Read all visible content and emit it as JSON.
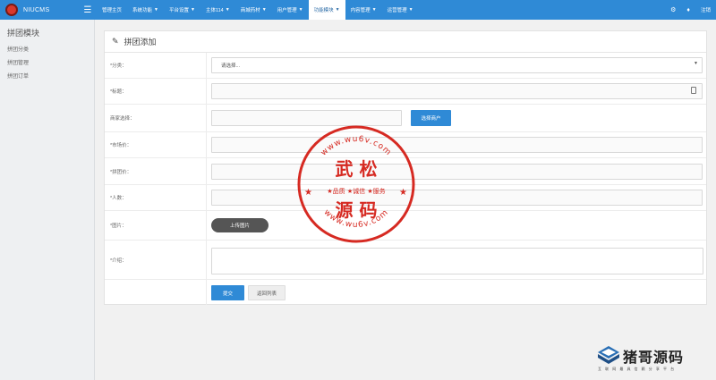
{
  "app": {
    "brand": "NIUCMS"
  },
  "nav": {
    "items": [
      {
        "label": "管理主页",
        "caret": false
      },
      {
        "label": "系统功能",
        "caret": true
      },
      {
        "label": "平台设置",
        "caret": true
      },
      {
        "label": "主体114",
        "caret": true
      },
      {
        "label": "商城药材",
        "caret": true
      },
      {
        "label": "用户管理",
        "caret": true
      },
      {
        "label": "功能模块",
        "caret": true,
        "active": true
      },
      {
        "label": "内容管理",
        "caret": true
      },
      {
        "label": "运营管理",
        "caret": true
      }
    ],
    "logout": "注销"
  },
  "sidebar": {
    "title": "拼团模块",
    "items": [
      "拼团分类",
      "拼团管理",
      "拼团订单"
    ]
  },
  "panel": {
    "title": "拼团添加",
    "fields": {
      "category_label": "*分类：",
      "category_value": "请选择...",
      "title_label": "*标题：",
      "merchant_label": "商家选择：",
      "merchant_button": "选择商户",
      "market_price_label": "*市场价：",
      "group_price_label": "*拼团价：",
      "people_label": "*人数：",
      "image_label": "*图片：",
      "upload_button": "上传图片",
      "intro_label": "*介绍："
    },
    "actions": {
      "submit": "提交",
      "back": "返回列表"
    }
  },
  "watermark": {
    "seal_top": "www.wu6v.com",
    "seal_bottom": "www.wu6v.com",
    "seal_line1": "武  松",
    "seal_line2": "★品质 ★诚信 ★服务",
    "seal_line3": "源  码",
    "corner_title": "猪哥源码",
    "corner_sub": "互 联 网 最 具 信 赖 分 享 平 台"
  },
  "colors": {
    "primary": "#2f8ad6",
    "seal_red": "#d62a22"
  }
}
